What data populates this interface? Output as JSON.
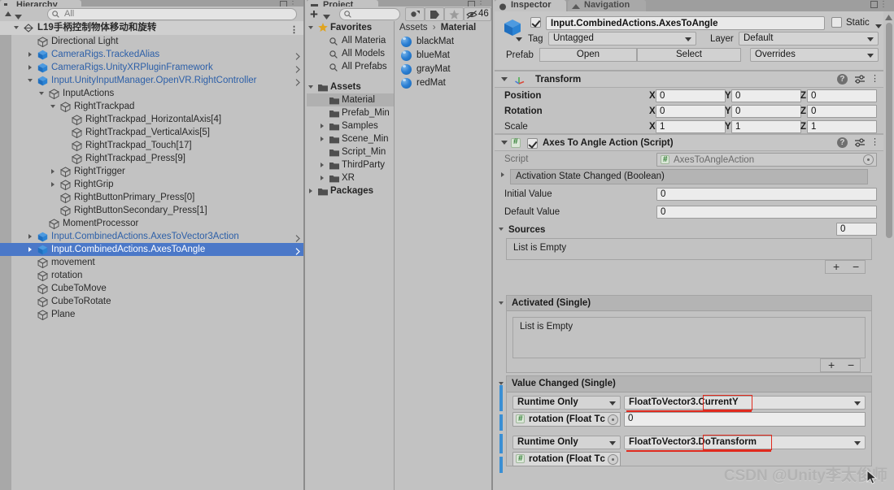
{
  "window": {
    "tabs": [
      {
        "name": "hierarchy-tab",
        "label": "Hierarchy",
        "active": true
      },
      {
        "name": "project-tab",
        "label": "Project",
        "active": true
      },
      {
        "name": "inspector-tab",
        "label": "Inspector",
        "active": true
      },
      {
        "name": "navigation-tab",
        "label": "Navigation",
        "active": false
      }
    ]
  },
  "hierarchy": {
    "search_placeholder": "All",
    "search_value": "",
    "scene_name": "L19手柄控制物体移动和旋转",
    "items": [
      {
        "label": "Directional Light",
        "depth": 2,
        "kind": "gameobject",
        "arrow": "none",
        "chevron": false
      },
      {
        "label": "CameraRigs.TrackedAlias",
        "depth": 2,
        "kind": "prefab",
        "arrow": "closed",
        "chevron": true
      },
      {
        "label": "CameraRigs.UnityXRPluginFramework",
        "depth": 2,
        "kind": "prefab",
        "arrow": "closed",
        "chevron": true
      },
      {
        "label": "Input.UnityInputManager.OpenVR.RightController",
        "depth": 2,
        "kind": "prefab",
        "arrow": "open",
        "chevron": true
      },
      {
        "label": "InputActions",
        "depth": 3,
        "kind": "gameobject",
        "arrow": "open",
        "chevron": false
      },
      {
        "label": "RightTrackpad",
        "depth": 4,
        "kind": "gameobject",
        "arrow": "open",
        "chevron": false
      },
      {
        "label": "RightTrackpad_HorizontalAxis[4]",
        "depth": 5,
        "kind": "gameobject",
        "arrow": "none",
        "chevron": false
      },
      {
        "label": "RightTrackpad_VerticalAxis[5]",
        "depth": 5,
        "kind": "gameobject",
        "arrow": "none",
        "chevron": false
      },
      {
        "label": "RightTrackpad_Touch[17]",
        "depth": 5,
        "kind": "gameobject",
        "arrow": "none",
        "chevron": false
      },
      {
        "label": "RightTrackpad_Press[9]",
        "depth": 5,
        "kind": "gameobject",
        "arrow": "none",
        "chevron": false
      },
      {
        "label": "RightTrigger",
        "depth": 4,
        "kind": "gameobject",
        "arrow": "closed",
        "chevron": false
      },
      {
        "label": "RightGrip",
        "depth": 4,
        "kind": "gameobject",
        "arrow": "closed",
        "chevron": false
      },
      {
        "label": "RightButtonPrimary_Press[0]",
        "depth": 4,
        "kind": "gameobject",
        "arrow": "none",
        "chevron": false
      },
      {
        "label": "RightButtonSecondary_Press[1]",
        "depth": 4,
        "kind": "gameobject",
        "arrow": "none",
        "chevron": false
      },
      {
        "label": "MomentProcessor",
        "depth": 3,
        "kind": "gameobject",
        "arrow": "none",
        "chevron": false
      },
      {
        "label": "Input.CombinedActions.AxesToVector3Action",
        "depth": 2,
        "kind": "prefab",
        "arrow": "closed",
        "chevron": true
      },
      {
        "label": "Input.CombinedActions.AxesToAngle",
        "depth": 2,
        "kind": "prefab-selected",
        "arrow": "closed",
        "chevron": true,
        "selected": true
      },
      {
        "label": "movement",
        "depth": 2,
        "kind": "gameobject",
        "arrow": "none",
        "chevron": false
      },
      {
        "label": "rotation",
        "depth": 2,
        "kind": "gameobject",
        "arrow": "none",
        "chevron": false
      },
      {
        "label": "CubeToMove",
        "depth": 2,
        "kind": "gameobject",
        "arrow": "none",
        "chevron": false
      },
      {
        "label": "CubeToRotate",
        "depth": 2,
        "kind": "gameobject",
        "arrow": "none",
        "chevron": false
      },
      {
        "label": "Plane",
        "depth": 2,
        "kind": "gameobject",
        "arrow": "none",
        "chevron": false
      }
    ]
  },
  "project": {
    "search_placeholder": "",
    "search_value": "",
    "hidden_count": "46",
    "tree": [
      {
        "label": "Favorites",
        "depth": 0,
        "icon": "star",
        "bold": true,
        "arrow": "open"
      },
      {
        "label": "All Materia",
        "depth": 1,
        "icon": "search",
        "bold": false,
        "arrow": "none"
      },
      {
        "label": "All Models",
        "depth": 1,
        "icon": "search",
        "bold": false,
        "arrow": "none"
      },
      {
        "label": "All Prefabs",
        "depth": 1,
        "icon": "search",
        "bold": false,
        "arrow": "none"
      },
      {
        "label": "",
        "depth": 0,
        "icon": "none",
        "bold": false,
        "arrow": "none"
      },
      {
        "label": "Assets",
        "depth": 0,
        "icon": "folder-open",
        "bold": true,
        "arrow": "open"
      },
      {
        "label": "Material",
        "depth": 1,
        "icon": "folder",
        "bold": false,
        "arrow": "none",
        "selected": true
      },
      {
        "label": "Prefab_Min",
        "depth": 1,
        "icon": "folder",
        "bold": false,
        "arrow": "none"
      },
      {
        "label": "Samples",
        "depth": 1,
        "icon": "folder",
        "bold": false,
        "arrow": "closed"
      },
      {
        "label": "Scene_Min",
        "depth": 1,
        "icon": "folder",
        "bold": false,
        "arrow": "closed"
      },
      {
        "label": "Script_Min",
        "depth": 1,
        "icon": "folder",
        "bold": false,
        "arrow": "none"
      },
      {
        "label": "ThirdParty",
        "depth": 1,
        "icon": "folder",
        "bold": false,
        "arrow": "closed"
      },
      {
        "label": "XR",
        "depth": 1,
        "icon": "folder",
        "bold": false,
        "arrow": "closed"
      },
      {
        "label": "Packages",
        "depth": 0,
        "icon": "folder",
        "bold": true,
        "arrow": "closed"
      }
    ],
    "breadcrumb_root": "Assets",
    "breadcrumb_sep": "›",
    "breadcrumb_leaf": "Material",
    "assets": [
      {
        "label": "blackMat",
        "icon": "material-ball"
      },
      {
        "label": "blueMat",
        "icon": "material-ball"
      },
      {
        "label": "grayMat",
        "icon": "material-ball"
      },
      {
        "label": "redMat",
        "icon": "material-ball"
      }
    ]
  },
  "inspector": {
    "gameobject": {
      "enabled": true,
      "name": "Input.CombinedActions.AxesToAngle",
      "static_label": "Static",
      "static_checked": false,
      "tag_label": "Tag",
      "tag_value": "Untagged",
      "layer_label": "Layer",
      "layer_value": "Default",
      "prefab_label": "Prefab",
      "prefab_open": "Open",
      "prefab_select": "Select",
      "prefab_overrides": "Overrides"
    },
    "transform": {
      "title": "Transform",
      "rows": [
        {
          "label": "Position",
          "x": "0",
          "y": "0",
          "z": "0"
        },
        {
          "label": "Rotation",
          "x": "0",
          "y": "0",
          "z": "0"
        },
        {
          "label": "Scale",
          "x": "1",
          "y": "1",
          "z": "1"
        }
      ],
      "axis_labels": [
        "X",
        "Y",
        "Z"
      ]
    },
    "script_component": {
      "title": "Axes To Angle Action (Script)",
      "enabled": true,
      "script_label": "Script",
      "script_value": "AxesToAngleAction",
      "activation_state_row": "Activation State Changed (Boolean)",
      "initial_value_label": "Initial Value",
      "initial_value": "0",
      "default_value_label": "Default Value",
      "default_value": "0",
      "sources_label": "Sources",
      "sources_count": "0",
      "sources_empty": "List is Empty",
      "activated_title": "Activated (Single)",
      "activated_empty": "List is Empty",
      "add_symbol": "+",
      "remove_symbol": "−",
      "value_changed_title": "Value Changed (Single)",
      "value_changed_entries": [
        {
          "call_state": "Runtime Only",
          "target_prefix": "FloatToVector3.",
          "target_member": "CurrentY",
          "object_ref": "rotation (Float Tс",
          "arg_value": "0",
          "has_arg": true,
          "highlight": "box-and-underline"
        },
        {
          "call_state": "Runtime Only",
          "target_prefix": "FloatToVector3.",
          "target_member": "DoTransform",
          "object_ref": "rotation (Float Tс",
          "arg_value": "",
          "has_arg": false,
          "highlight": "box-and-underline"
        }
      ]
    }
  },
  "watermark": "CSDN @Unity李太俊师",
  "colors": {
    "selection_blue": "#4b78c8",
    "prefab_blue": "#2c5fa8",
    "override_bar": "#3a8fd4",
    "highlight_red": "#e02a1e",
    "panel_bg": "#c2c2c2"
  }
}
